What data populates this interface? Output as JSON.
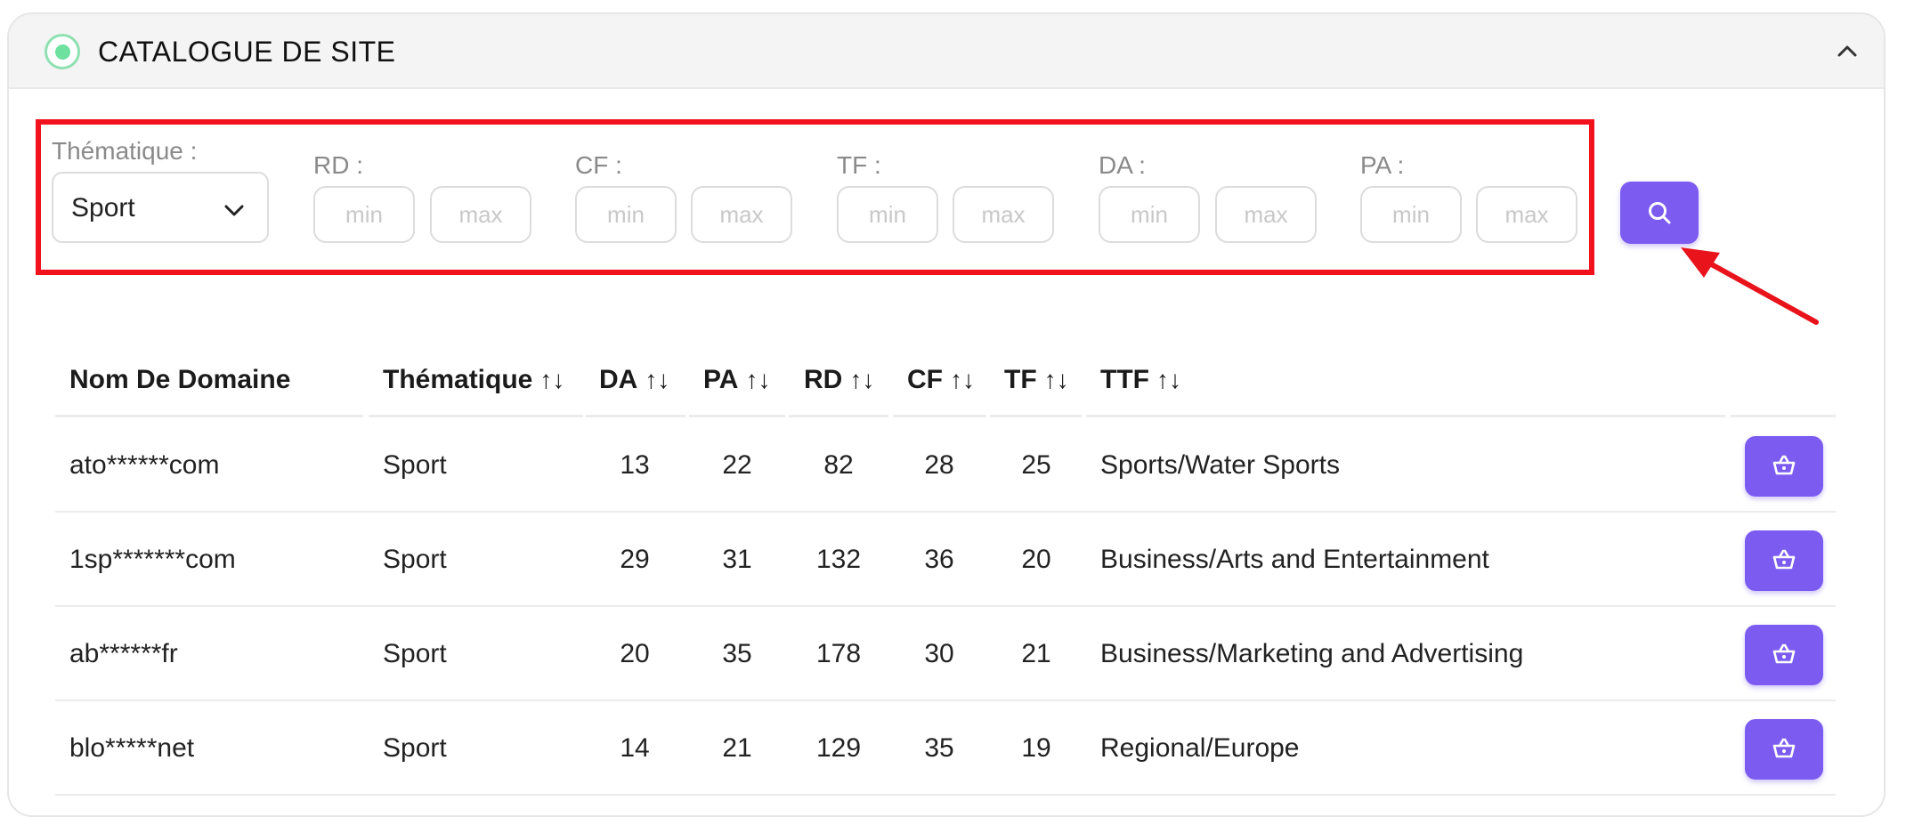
{
  "header": {
    "title": "CATALOGUE DE SITE",
    "status_icon": "status-dot-icon",
    "collapse_icon": "chevron-up-icon"
  },
  "filters": {
    "thematique": {
      "label": "Thématique :",
      "value": "Sport"
    },
    "ranges": [
      {
        "label": "RD :",
        "min_placeholder": "min",
        "max_placeholder": "max"
      },
      {
        "label": "CF :",
        "min_placeholder": "min",
        "max_placeholder": "max"
      },
      {
        "label": "TF :",
        "min_placeholder": "min",
        "max_placeholder": "max"
      },
      {
        "label": "DA :",
        "min_placeholder": "min",
        "max_placeholder": "max"
      },
      {
        "label": "PA :",
        "min_placeholder": "min",
        "max_placeholder": "max"
      }
    ],
    "search_icon": "search-icon"
  },
  "annotation": {
    "highlight_color": "#f2121d",
    "arrow_color": "#e8131b"
  },
  "colors": {
    "accent": "#7c5cf0",
    "status": "#6ee09f"
  },
  "table": {
    "columns": [
      "Nom De Domaine",
      "Thématique",
      "DA",
      "PA",
      "RD",
      "CF",
      "TF",
      "TTF"
    ],
    "sort_glyph": "↑↓",
    "rows": [
      {
        "domain": "ato******com",
        "thematique": "Sport",
        "da": "13",
        "pa": "22",
        "rd": "82",
        "cf": "28",
        "tf": "25",
        "ttf": "Sports/Water Sports"
      },
      {
        "domain": "1sp*******com",
        "thematique": "Sport",
        "da": "29",
        "pa": "31",
        "rd": "132",
        "cf": "36",
        "tf": "20",
        "ttf": "Business/Arts and Entertainment"
      },
      {
        "domain": "ab******fr",
        "thematique": "Sport",
        "da": "20",
        "pa": "35",
        "rd": "178",
        "cf": "30",
        "tf": "21",
        "ttf": "Business/Marketing and Advertising"
      },
      {
        "domain": "blo*****net",
        "thematique": "Sport",
        "da": "14",
        "pa": "21",
        "rd": "129",
        "cf": "35",
        "tf": "19",
        "ttf": "Regional/Europe"
      }
    ],
    "row_action_icon": "basket-icon"
  }
}
